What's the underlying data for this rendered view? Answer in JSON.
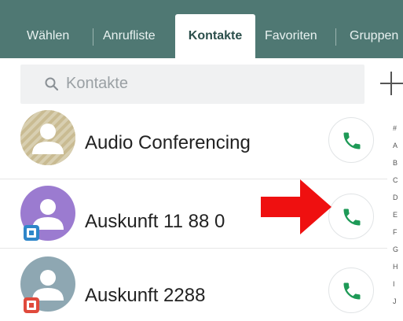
{
  "tabs": [
    {
      "label": "Wählen",
      "active": false
    },
    {
      "label": "Anrufliste",
      "active": false
    },
    {
      "label": "Kontakte",
      "active": true
    },
    {
      "label": "Favoriten",
      "active": false
    },
    {
      "label": "Gruppen",
      "active": false
    }
  ],
  "search": {
    "placeholder": "Kontakte",
    "icon": "search-icon"
  },
  "add_button": {
    "icon": "plus-icon"
  },
  "contacts": [
    {
      "name": "Audio Conferencing",
      "avatar_color": "#c6b88e",
      "call_icon": "phone-icon"
    },
    {
      "name": "Auskunft 11 88 0",
      "avatar_color": "#9b7bd0",
      "badge_icon": "sim-card-icon",
      "call_icon": "phone-icon"
    },
    {
      "name": "Auskunft 2288",
      "avatar_color": "#8ea7b2",
      "badge_icon": "sim-card-icon",
      "call_icon": "phone-icon"
    }
  ],
  "index_letters": [
    "#",
    "A",
    "B",
    "C",
    "D",
    "E",
    "F",
    "G",
    "H",
    "I",
    "J"
  ],
  "colors": {
    "tabbar": "#4f7873",
    "phone_green": "#1e9a57",
    "arrow_red": "#ef1010"
  }
}
